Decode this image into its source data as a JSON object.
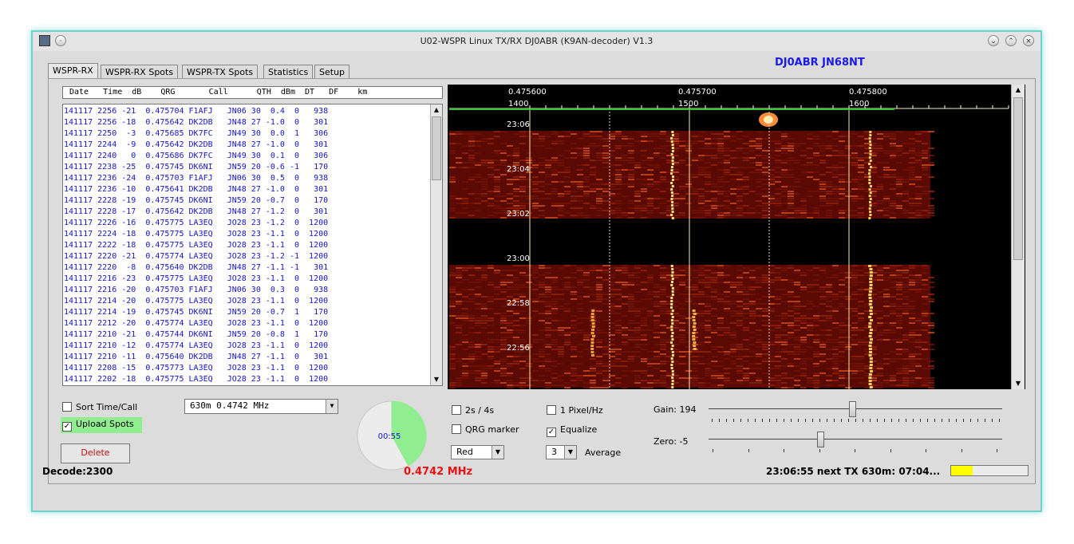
{
  "window": {
    "title": "U02-WSPR Linux TX/RX DJ0ABR (K9AN-decoder) V1.3"
  },
  "tabs": [
    "WSPR-RX",
    "WSPR-RX Spots",
    "WSPR-TX Spots",
    "Statistics",
    "Setup"
  ],
  "station": "DJ0ABR JN68NT",
  "spot_header": "Date   Time  dB    QRG       Call      QTH  dBm  DT   DF    km",
  "spots": [
    [
      "141117",
      "2256",
      "-21",
      "0.475704",
      "F1AFJ",
      "JN06",
      "30",
      "0.4",
      "0",
      "938"
    ],
    [
      "141117",
      "2256",
      "-18",
      "0.475642",
      "DK2DB",
      "JN48",
      "27",
      "-1.0",
      "0",
      "301"
    ],
    [
      "141117",
      "2250",
      "-3",
      "0.475685",
      "DK7FC",
      "JN49",
      "30",
      "0.0",
      "1",
      "306"
    ],
    [
      "141117",
      "2244",
      "-9",
      "0.475642",
      "DK2DB",
      "JN48",
      "27",
      "-1.0",
      "0",
      "301"
    ],
    [
      "141117",
      "2240",
      "0",
      "0.475686",
      "DK7FC",
      "JN49",
      "30",
      "0.1",
      "0",
      "306"
    ],
    [
      "141117",
      "2238",
      "-25",
      "0.475745",
      "DK6NI",
      "JN59",
      "20",
      "-0.6",
      "-1",
      "170"
    ],
    [
      "141117",
      "2236",
      "-24",
      "0.475703",
      "F1AFJ",
      "JN06",
      "30",
      "0.5",
      "0",
      "938"
    ],
    [
      "141117",
      "2236",
      "-10",
      "0.475641",
      "DK2DB",
      "JN48",
      "27",
      "-1.0",
      "0",
      "301"
    ],
    [
      "141117",
      "2228",
      "-19",
      "0.475745",
      "DK6NI",
      "JN59",
      "20",
      "-0.7",
      "0",
      "170"
    ],
    [
      "141117",
      "2228",
      "-17",
      "0.475642",
      "DK2DB",
      "JN48",
      "27",
      "-1.2",
      "0",
      "301"
    ],
    [
      "141117",
      "2226",
      "-16",
      "0.475775",
      "LA3EQ",
      "JO28",
      "23",
      "-1.2",
      "0",
      "1200"
    ],
    [
      "141117",
      "2224",
      "-18",
      "0.475775",
      "LA3EQ",
      "JO28",
      "23",
      "-1.1",
      "0",
      "1200"
    ],
    [
      "141117",
      "2222",
      "-18",
      "0.475775",
      "LA3EQ",
      "JO28",
      "23",
      "-1.1",
      "0",
      "1200"
    ],
    [
      "141117",
      "2220",
      "-21",
      "0.475774",
      "LA3EQ",
      "JO28",
      "23",
      "-1.2",
      "-1",
      "1200"
    ],
    [
      "141117",
      "2220",
      "-8",
      "0.475640",
      "DK2DB",
      "JN48",
      "27",
      "-1.1",
      "-1",
      "301"
    ],
    [
      "141117",
      "2216",
      "-23",
      "0.475775",
      "LA3EQ",
      "JO28",
      "23",
      "-1.1",
      "0",
      "1200"
    ],
    [
      "141117",
      "2216",
      "-20",
      "0.475703",
      "F1AFJ",
      "JN06",
      "30",
      "0.3",
      "0",
      "938"
    ],
    [
      "141117",
      "2214",
      "-20",
      "0.475775",
      "LA3EQ",
      "JO28",
      "23",
      "-1.1",
      "0",
      "1200"
    ],
    [
      "141117",
      "2214",
      "-19",
      "0.475745",
      "DK6NI",
      "JN59",
      "20",
      "-0.7",
      "1",
      "170"
    ],
    [
      "141117",
      "2212",
      "-20",
      "0.475774",
      "LA3EQ",
      "JO28",
      "23",
      "-1.1",
      "0",
      "1200"
    ],
    [
      "141117",
      "2210",
      "-21",
      "0.475744",
      "DK6NI",
      "JN59",
      "20",
      "-0.8",
      "1",
      "170"
    ],
    [
      "141117",
      "2210",
      "-12",
      "0.475774",
      "LA3EQ",
      "JO28",
      "23",
      "-1.1",
      "0",
      "1200"
    ],
    [
      "141117",
      "2210",
      "-11",
      "0.475640",
      "DK2DB",
      "JN48",
      "27",
      "-1.1",
      "0",
      "301"
    ],
    [
      "141117",
      "2208",
      "-15",
      "0.475773",
      "LA3EQ",
      "JO28",
      "23",
      "-1.1",
      "0",
      "1200"
    ],
    [
      "141117",
      "2202",
      "-18",
      "0.475775",
      "LA3EQ",
      "JO28",
      "23",
      "-1.1",
      "0",
      "1200"
    ]
  ],
  "waterfall": {
    "freq_labels": [
      "0.475600",
      "0.475700",
      "0.475800"
    ],
    "hz_labels": [
      "1400",
      "1500",
      "1600"
    ],
    "time_labels": [
      "23:06",
      "23:04",
      "23:02",
      "23:00",
      "22:58",
      "22:56"
    ]
  },
  "controls": {
    "sort_label": "Sort Time/Call",
    "sort_checked": false,
    "upload_label": "Upload Spots",
    "upload_checked": true,
    "delete_label": "Delete",
    "band_select": "630m   0.4742 MHz",
    "timer": "00:55",
    "timer_fraction": 0.42,
    "mode_label": "2s / 4s",
    "mode_checked": false,
    "qrg_label": "QRG marker",
    "qrg_checked": false,
    "color_select": "Red",
    "pixel_label": "1 Pixel/Hz",
    "pixel_checked": false,
    "equalize_label": "Equalize",
    "equalize_checked": true,
    "average_value": "3",
    "average_label": "Average",
    "gain_label": "Gain: 194",
    "gain_fraction": 0.49,
    "zero_label": "Zero: -5",
    "zero_fraction": 0.38
  },
  "status": {
    "decode": "Decode:2300",
    "frequency": "0.4742 MHz",
    "clock": "23:06:55   next TX 630m: 07:04...",
    "tx_progress": 0.28,
    "tx_color": "#ffff00"
  }
}
